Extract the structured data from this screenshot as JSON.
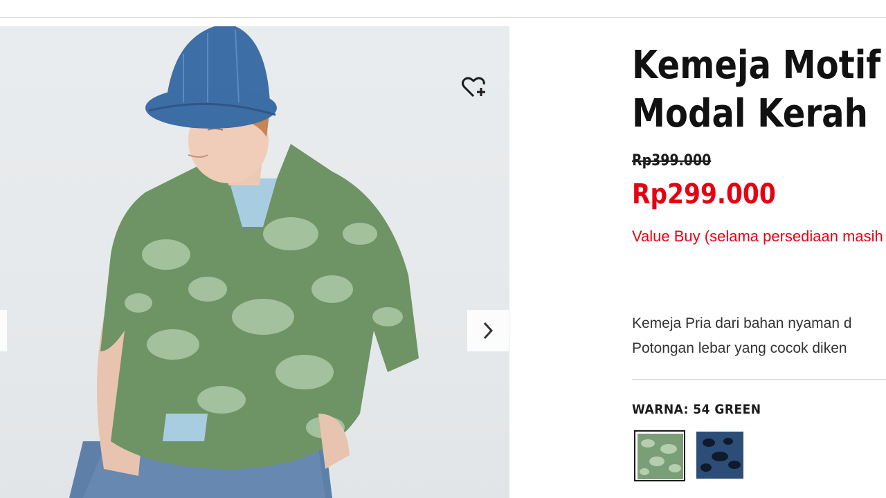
{
  "product": {
    "title_line1": "Kemeja Motif",
    "title_line2": "Modal Kerah",
    "price_original": "Rp399.000",
    "price_sale": "Rp299.000",
    "promo_text": "Value Buy (selama persediaan masih ada)",
    "description_line1": "Kemeja Pria dari bahan nyaman d",
    "description_line2": "Potongan lebar yang cocok diken"
  },
  "color": {
    "label": "WARNA: 54 GREEN",
    "options": [
      {
        "name": "54 GREEN",
        "hex": "#7a9e76",
        "selected": true
      },
      {
        "name": "NAVY",
        "hex": "#2c4d78",
        "selected": false
      }
    ]
  },
  "gallery": {
    "wishlist_icon": "heart-plus-icon",
    "next_icon": "chevron-right-icon",
    "prev_icon": "chevron-left-icon"
  },
  "colors": {
    "sale_red": "#e60012",
    "text": "#1b1b1b"
  }
}
